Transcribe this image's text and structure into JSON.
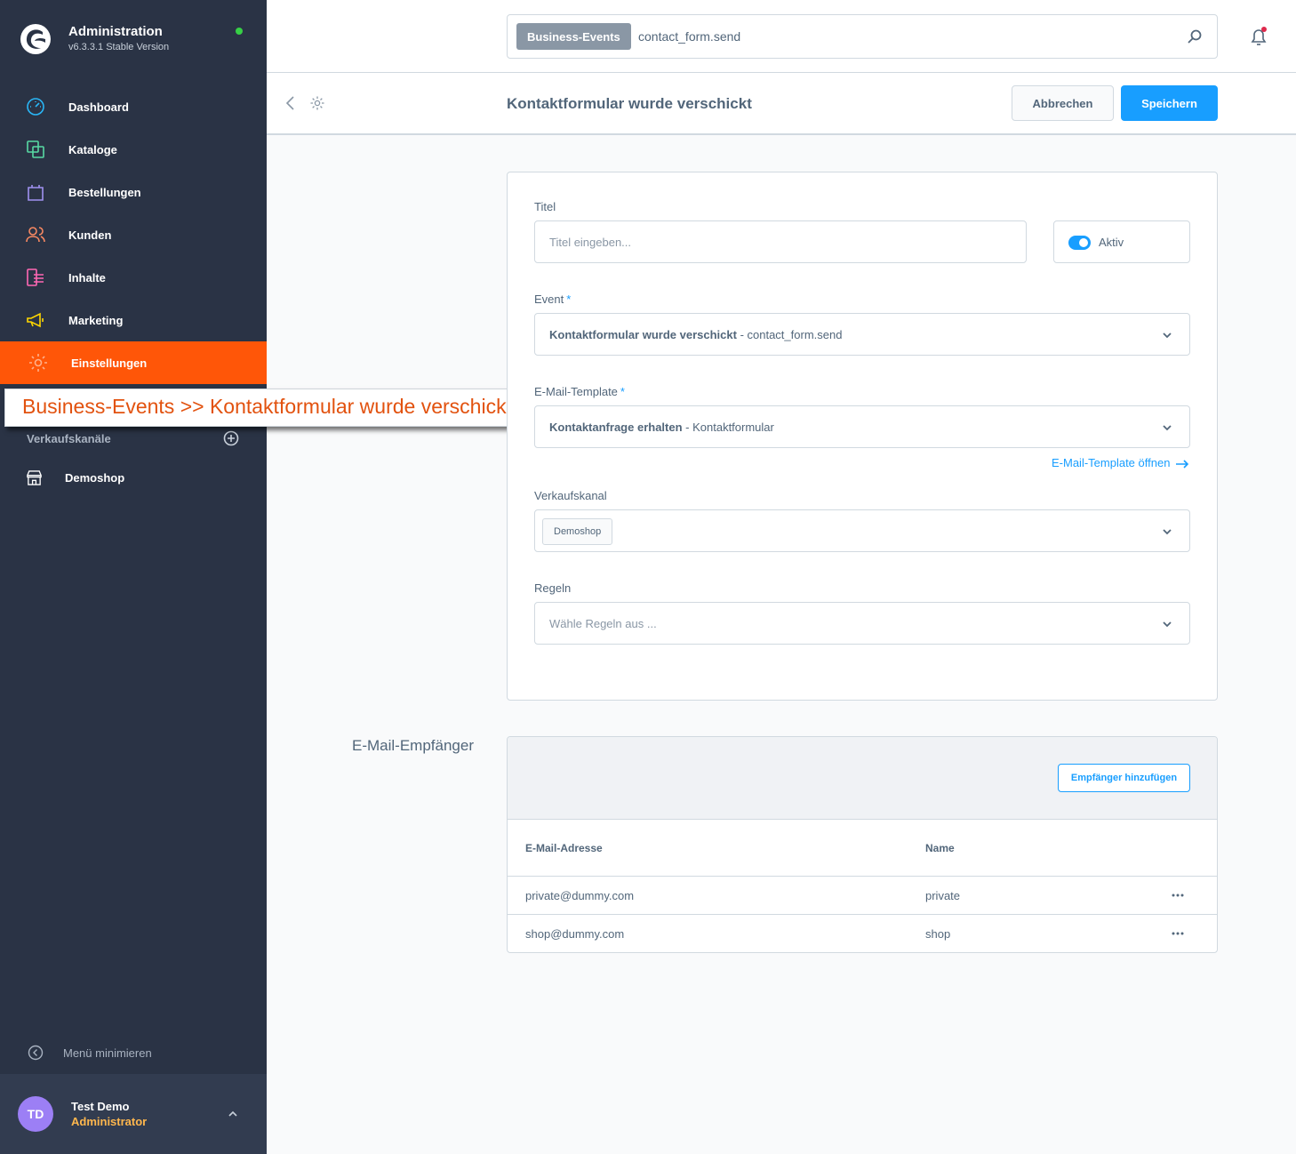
{
  "sidebar": {
    "title": "Administration",
    "version": "v6.3.3.1 Stable Version",
    "nav": [
      {
        "label": "Dashboard",
        "icon": "dashboard-icon"
      },
      {
        "label": "Kataloge",
        "icon": "catalog-icon"
      },
      {
        "label": "Bestellungen",
        "icon": "orders-icon"
      },
      {
        "label": "Kunden",
        "icon": "customers-icon"
      },
      {
        "label": "Inhalte",
        "icon": "content-icon"
      },
      {
        "label": "Marketing",
        "icon": "marketing-icon"
      },
      {
        "label": "Einstellungen",
        "icon": "settings-icon",
        "active": true
      }
    ],
    "callout": "Business-Events >> Kontaktformular wurde verschickt",
    "sales_channels_label": "Verkaufskanäle",
    "shop_label": "Demoshop",
    "minimize_label": "Menü minimieren",
    "user": {
      "initials": "TD",
      "name": "Test Demo",
      "role": "Administrator"
    }
  },
  "topbar": {
    "search_tag": "Business-Events",
    "search_value": "contact_form.send"
  },
  "smartbar": {
    "title": "Kontaktformular wurde verschickt",
    "cancel_label": "Abbrechen",
    "save_label": "Speichern"
  },
  "form": {
    "title_label": "Titel",
    "title_placeholder": "Titel eingeben...",
    "active_label": "Aktiv",
    "active": true,
    "event_label": "Event",
    "event_bold": "Kontaktformular wurde verschickt",
    "event_rest": " - contact_form.send",
    "template_label": "E-Mail-Template",
    "template_bold": "Kontaktanfrage erhalten",
    "template_rest": " - Kontaktformular",
    "template_link": "E-Mail-Template öffnen",
    "channel_label": "Verkaufskanal",
    "channel_chip": "Demoshop",
    "rules_label": "Regeln",
    "rules_placeholder": "Wähle Regeln aus ...",
    "required_mark": "*"
  },
  "recipients": {
    "title": "E-Mail-Empfänger",
    "add_label": "Empfänger hinzufügen",
    "columns": [
      "E-Mail-Adresse",
      "Name"
    ],
    "rows": [
      {
        "email": "private@dummy.com",
        "name": "private"
      },
      {
        "email": "shop@dummy.com",
        "name": "shop"
      }
    ]
  },
  "colors": {
    "sidebar_bg": "#2a3345",
    "active_nav": "#ff5608",
    "primary": "#189eff",
    "callout_text": "#e2520f"
  }
}
